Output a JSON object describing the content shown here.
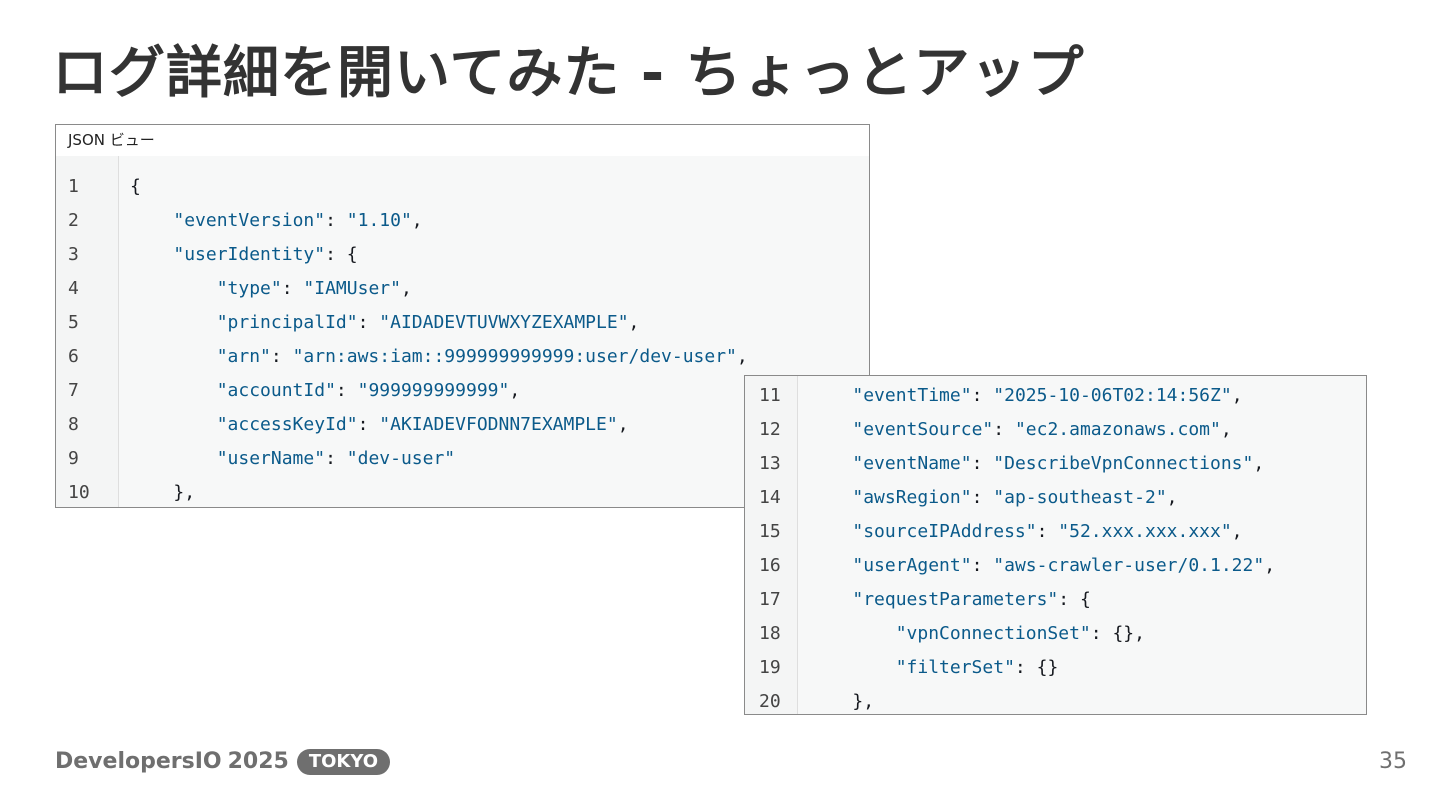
{
  "slide": {
    "title": "ログ詳細を開いてみた - ちょっとアップ",
    "page_number": "35"
  },
  "footer": {
    "brand": "DevelopersIO",
    "year": "2025",
    "badge": "TOKYO"
  },
  "panel_a": {
    "caption": "JSON ビュー",
    "lines": [
      {
        "n": "1",
        "indent": "",
        "key": "",
        "sep": "",
        "val": "",
        "tail": "{"
      },
      {
        "n": "2",
        "indent": "    ",
        "key": "\"eventVersion\"",
        "sep": ": ",
        "val": "\"1.10\"",
        "tail": ","
      },
      {
        "n": "3",
        "indent": "    ",
        "key": "\"userIdentity\"",
        "sep": ": ",
        "val": "",
        "tail": "{"
      },
      {
        "n": "4",
        "indent": "        ",
        "key": "\"type\"",
        "sep": ": ",
        "val": "\"IAMUser\"",
        "tail": ","
      },
      {
        "n": "5",
        "indent": "        ",
        "key": "\"principalId\"",
        "sep": ": ",
        "val": "\"AIDADEVTUVWXYZEXAMPLE\"",
        "tail": ","
      },
      {
        "n": "6",
        "indent": "        ",
        "key": "\"arn\"",
        "sep": ": ",
        "val": "\"arn:aws:iam::999999999999:user/dev-user\"",
        "tail": ","
      },
      {
        "n": "7",
        "indent": "        ",
        "key": "\"accountId\"",
        "sep": ": ",
        "val": "\"999999999999\"",
        "tail": ","
      },
      {
        "n": "8",
        "indent": "        ",
        "key": "\"accessKeyId\"",
        "sep": ": ",
        "val": "\"AKIADEVFODNN7EXAMPLE\"",
        "tail": ","
      },
      {
        "n": "9",
        "indent": "        ",
        "key": "\"userName\"",
        "sep": ": ",
        "val": "\"dev-user\"",
        "tail": ""
      },
      {
        "n": "10",
        "indent": "    ",
        "key": "",
        "sep": "",
        "val": "",
        "tail": "},"
      }
    ]
  },
  "panel_b": {
    "lines": [
      {
        "n": "11",
        "indent": "    ",
        "key": "\"eventTime\"",
        "sep": ": ",
        "val": "\"2025-10-06T02:14:56Z\"",
        "tail": ","
      },
      {
        "n": "12",
        "indent": "    ",
        "key": "\"eventSource\"",
        "sep": ": ",
        "val": "\"ec2.amazonaws.com\"",
        "tail": ","
      },
      {
        "n": "13",
        "indent": "    ",
        "key": "\"eventName\"",
        "sep": ": ",
        "val": "\"DescribeVpnConnections\"",
        "tail": ","
      },
      {
        "n": "14",
        "indent": "    ",
        "key": "\"awsRegion\"",
        "sep": ": ",
        "val": "\"ap-southeast-2\"",
        "tail": ","
      },
      {
        "n": "15",
        "indent": "    ",
        "key": "\"sourceIPAddress\"",
        "sep": ": ",
        "val": "\"52.xxx.xxx.xxx\"",
        "tail": ","
      },
      {
        "n": "16",
        "indent": "    ",
        "key": "\"userAgent\"",
        "sep": ": ",
        "val": "\"aws-crawler-user/0.1.22\"",
        "tail": ","
      },
      {
        "n": "17",
        "indent": "    ",
        "key": "\"requestParameters\"",
        "sep": ": ",
        "val": "",
        "tail": "{"
      },
      {
        "n": "18",
        "indent": "        ",
        "key": "\"vpnConnectionSet\"",
        "sep": ": ",
        "val": "",
        "tail": "{},"
      },
      {
        "n": "19",
        "indent": "        ",
        "key": "\"filterSet\"",
        "sep": ": ",
        "val": "",
        "tail": "{}"
      },
      {
        "n": "20",
        "indent": "    ",
        "key": "",
        "sep": "",
        "val": "",
        "tail": "},"
      }
    ]
  }
}
